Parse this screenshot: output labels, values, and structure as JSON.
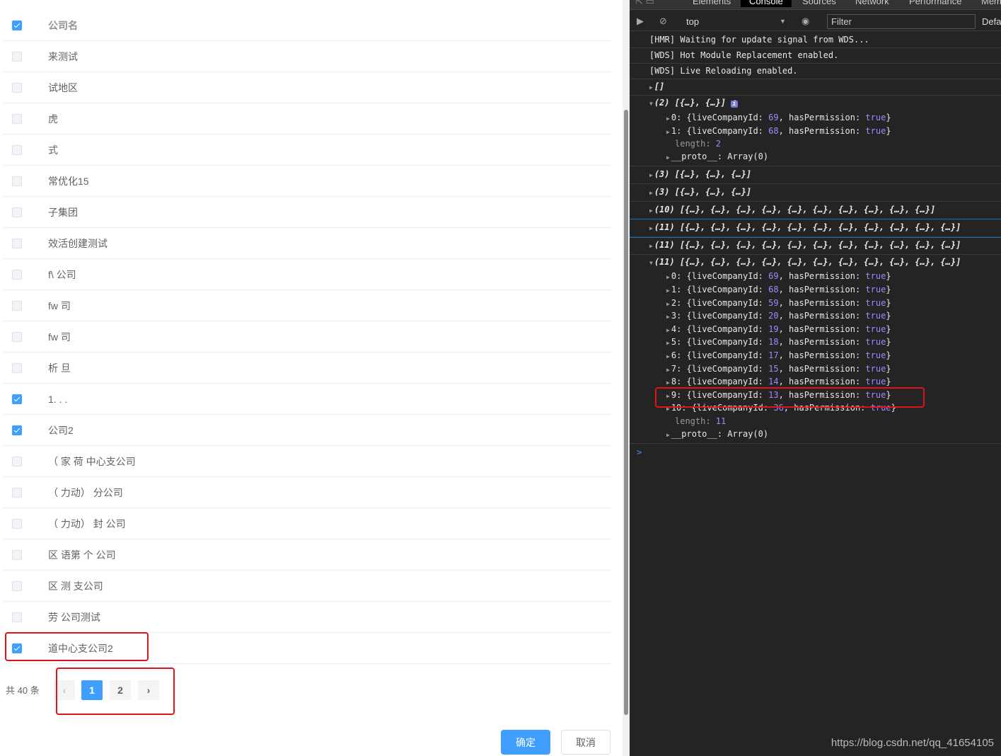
{
  "table": {
    "header": "公司名",
    "rows": [
      {
        "name": "  来测试",
        "checked": false
      },
      {
        "name": " 试地区",
        "checked": false
      },
      {
        "name": "虎",
        "checked": false
      },
      {
        "name": "式",
        "checked": false
      },
      {
        "name": "常优化15",
        "checked": false
      },
      {
        "name": "子集团",
        "checked": false
      },
      {
        "name": "效活创建测试",
        "checked": false
      },
      {
        "name": "f\\   公司",
        "checked": false
      },
      {
        "name": "fw   司",
        "checked": false
      },
      {
        "name": "fw   司",
        "checked": false
      },
      {
        "name": "析    旦",
        "checked": false
      },
      {
        "name": "1. . .",
        "checked": true
      },
      {
        "name": "  公司2",
        "checked": true
      },
      {
        "name": "（  家  荷  中心支公司",
        "checked": false
      },
      {
        "name": "（ 力动） 分公司",
        "checked": false
      },
      {
        "name": "（ 力动）  封  公司",
        "checked": false
      },
      {
        "name": "区 语第 个  公司",
        "checked": false
      },
      {
        "name": "区  测  支公司",
        "checked": false
      },
      {
        "name": "  劳 公司测试",
        "checked": false
      },
      {
        "name": "  道中心支公司2",
        "checked": true
      }
    ]
  },
  "pagination": {
    "total": "共 40 条",
    "pages": [
      "1",
      "2"
    ],
    "current": "1",
    "prev": "‹",
    "next": "›"
  },
  "buttons": {
    "ok": "确定",
    "cancel": "取消"
  },
  "devtools": {
    "tabs": [
      "Elements",
      "Console",
      "Sources",
      "Network",
      "Performance",
      "Mem"
    ],
    "active_tab": "Console",
    "context": "top",
    "filter_placeholder": "Filter",
    "levels": "Defa",
    "logs": [
      "[HMR] Waiting for update signal from WDS...",
      "[WDS] Hot Module Replacement enabled.",
      "[WDS] Live Reloading enabled.",
      "[]"
    ],
    "group1": {
      "summary": "(2) [{…}, {…}]",
      "items": [
        {
          "i": "0",
          "id": "69"
        },
        {
          "i": "1",
          "id": "68"
        }
      ],
      "length": "2"
    },
    "collapsed": [
      "(3) [{…}, {…}, {…}]",
      "(3) [{…}, {…}, {…}]",
      "(10) [{…}, {…}, {…}, {…}, {…}, {…}, {…}, {…}, {…}, {…}]",
      "(11) [{…}, {…}, {…}, {…}, {…}, {…}, {…}, {…}, {…}, {…}, {…}]",
      "(11) [{…}, {…}, {…}, {…}, {…}, {…}, {…}, {…}, {…}, {…}, {…}]"
    ],
    "group2": {
      "summary": "(11) [{…}, {…}, {…}, {…}, {…}, {…}, {…}, {…}, {…}, {…}, {…}]",
      "items": [
        {
          "i": "0",
          "id": "69"
        },
        {
          "i": "1",
          "id": "68"
        },
        {
          "i": "2",
          "id": "59"
        },
        {
          "i": "3",
          "id": "20"
        },
        {
          "i": "4",
          "id": "19"
        },
        {
          "i": "5",
          "id": "18"
        },
        {
          "i": "6",
          "id": "17"
        },
        {
          "i": "7",
          "id": "15"
        },
        {
          "i": "8",
          "id": "14"
        },
        {
          "i": "9",
          "id": "13"
        },
        {
          "i": "10",
          "id": "36"
        }
      ],
      "length": "11"
    },
    "key_id": "liveCompanyId",
    "key_perm": "hasPermission",
    "perm_value": "true",
    "proto": "__proto__: Array(0)",
    "prompt": ">"
  },
  "watermark": "https://blog.csdn.net/qq_41654105",
  "colors": {
    "primary": "#409eff",
    "highlight": "#e0121b",
    "console_bg": "#242424"
  }
}
